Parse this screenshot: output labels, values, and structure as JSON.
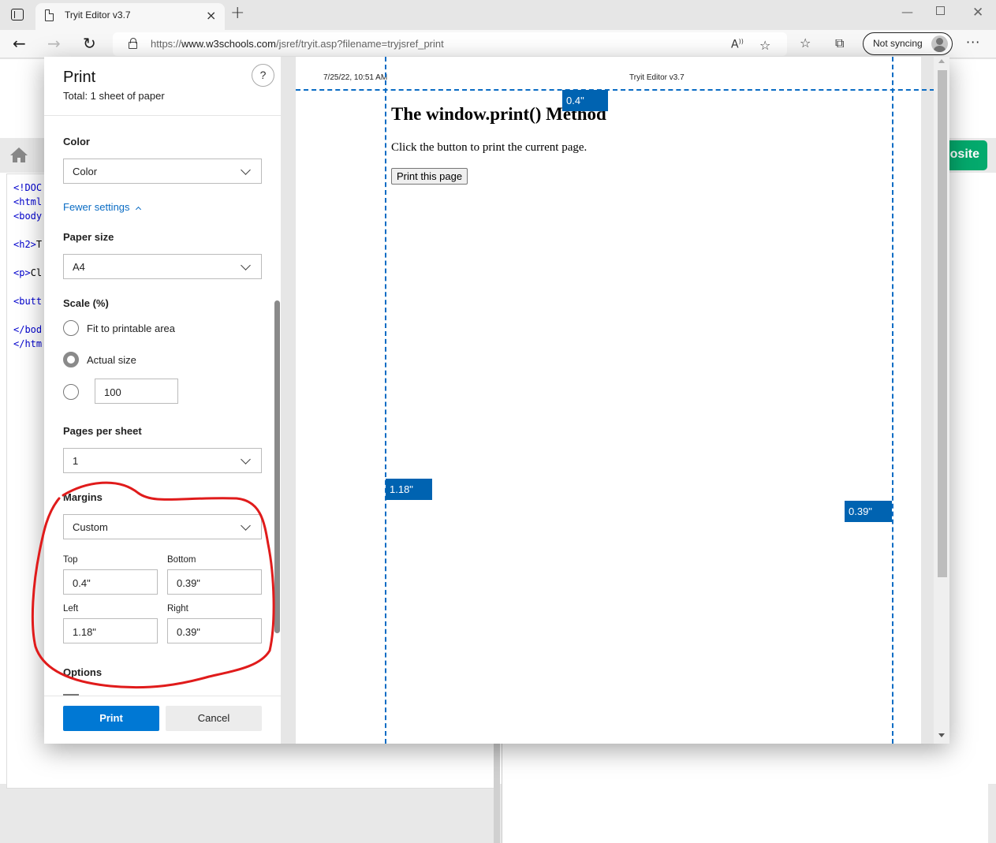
{
  "browser": {
    "tab_title": "Tryit Editor v3.7",
    "url_prefix": "https://",
    "url_domain": "www.w3schools.com",
    "url_path": "/jsref/tryit.asp?filename=tryjsref_print",
    "sync_label": "Not syncing",
    "icons": [
      "tab-actions-icon",
      "page-icon",
      "close-icon",
      "plus-icon",
      "back-icon",
      "forward-icon",
      "refresh-icon",
      "lock-icon",
      "read-aloud-icon",
      "add-favorite-icon",
      "favorites-icon",
      "collections-icon",
      "avatar-icon",
      "more-icon",
      "minimize-icon",
      "maximize-icon",
      "window-close-icon"
    ]
  },
  "background_page": {
    "code_lines": [
      {
        "prefix": "<!DOC",
        "rest": ""
      },
      {
        "prefix": "<html",
        "rest": ""
      },
      {
        "prefix": "<body",
        "rest": ""
      },
      {
        "prefix": "<h2>",
        "rest": "T"
      },
      {
        "prefix": "<p>",
        "rest": "Cl"
      },
      {
        "prefix": "<butt",
        "rest": ""
      },
      {
        "prefix": "</bod",
        "rest": ""
      },
      {
        "prefix": "</htm",
        "rest": ""
      }
    ],
    "website_button": "osite"
  },
  "print_dialog": {
    "title": "Print",
    "total": "Total: 1 sheet of paper",
    "help": "?",
    "color": {
      "label": "Color",
      "value": "Color"
    },
    "fewer_settings": "Fewer settings",
    "paper_size": {
      "label": "Paper size",
      "value": "A4"
    },
    "scale": {
      "label": "Scale (%)",
      "options": [
        {
          "label": "Fit to printable area",
          "checked": false
        },
        {
          "label": "Actual size",
          "checked": true
        },
        {
          "label": "",
          "checked": false
        }
      ],
      "custom_value": "100"
    },
    "pages_per_sheet": {
      "label": "Pages per sheet",
      "value": "1"
    },
    "margins": {
      "label": "Margins",
      "value": "Custom",
      "top_label": "Top",
      "top": "0.4\"",
      "bottom_label": "Bottom",
      "bottom": "0.39\"",
      "left_label": "Left",
      "left": "1.18\"",
      "right_label": "Right",
      "right": "0.39\""
    },
    "options_label": "Options",
    "print_button": "Print",
    "cancel_button": "Cancel"
  },
  "preview": {
    "header_date": "7/25/22, 10:51 AM",
    "header_title": "Tryit Editor v3.7",
    "heading": "The window.print() Method",
    "paragraph": "Click the button to print the current page.",
    "button": "Print this page",
    "margin_tags": {
      "top": "0.4\"",
      "left": "1.18\"",
      "right": "0.39\""
    }
  },
  "annotation": {
    "shape": "freehand-circle",
    "target": "margins-section",
    "color": "#e01b1b"
  }
}
